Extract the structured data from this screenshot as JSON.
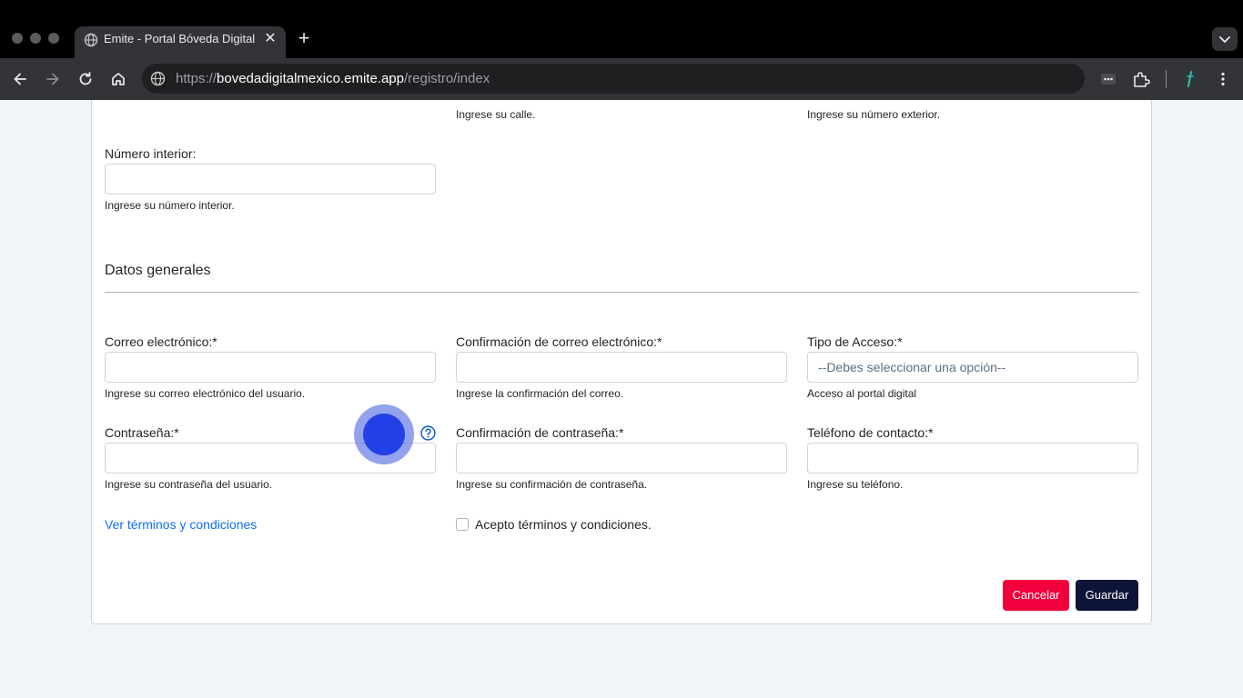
{
  "browser": {
    "tab_title": "Emite - Portal Bóveda Digital",
    "url_protocol": "https://",
    "url_host": "bovedadigitalmexico.emite.app",
    "url_path": "/registro/index"
  },
  "form": {
    "address": {
      "calle_help": "Ingrese su calle.",
      "numero_exterior_help": "Ingrese su número exterior.",
      "numero_interior_label": "Número interior:",
      "numero_interior_help": "Ingrese su número interior."
    },
    "general": {
      "section_title": "Datos generales",
      "correo_label": "Correo electrónico:*",
      "correo_help": "Ingrese su correo electrónico del usuario.",
      "confirm_correo_label": "Confirmación de correo electrónico:*",
      "confirm_correo_help": "Ingrese la confirmación del correo.",
      "tipo_acceso_label": "Tipo de Acceso:*",
      "tipo_acceso_selected": "--Debes seleccionar una opción--",
      "tipo_acceso_help": "Acceso al portal digital",
      "password_label": "Contraseña:*",
      "password_help": "Ingrese su contraseña del usuario.",
      "confirm_password_label": "Confirmación de contraseña:*",
      "confirm_password_help": "Ingrese su confirmación de contraseña.",
      "telefono_label": "Teléfono de contacto:*",
      "telefono_help": "Ingrese su teléfono.",
      "terms_link": "Ver términos y condiciones",
      "terms_checkbox_label": "Acepto términos y condiciones."
    },
    "actions": {
      "cancel_label": "Cancelar",
      "save_label": "Guardar"
    }
  },
  "colors": {
    "cancel_button": "#f0003c",
    "save_button": "#0e1438",
    "link": "#0d6efd",
    "cursor_indicator": "#2340e6"
  }
}
